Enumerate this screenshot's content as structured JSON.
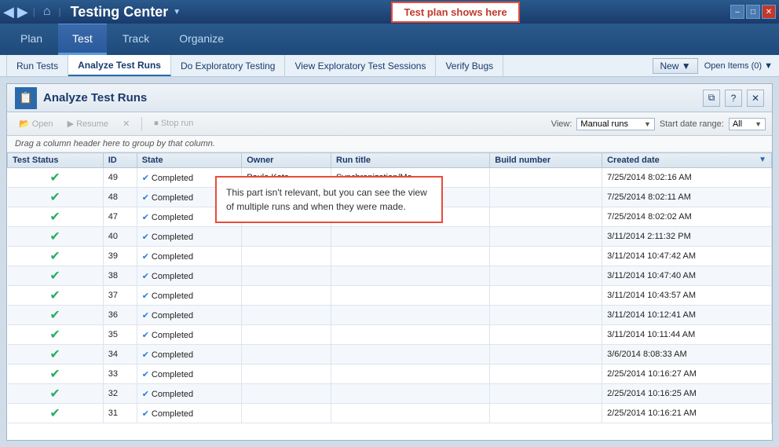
{
  "window": {
    "title": "Testing Center",
    "min_label": "–",
    "max_label": "□",
    "close_label": "✕"
  },
  "titlebar": {
    "back_icon": "◀",
    "forward_icon": "▶",
    "home_icon": "⌂",
    "dropdown_arrow": "▼",
    "test_plan_badge": "Test plan shows here"
  },
  "top_nav": {
    "items": [
      {
        "label": "Plan",
        "active": false
      },
      {
        "label": "Test",
        "active": true
      },
      {
        "label": "Track",
        "active": false
      },
      {
        "label": "Organize",
        "active": false
      }
    ]
  },
  "secondary_nav": {
    "items": [
      {
        "label": "Run Tests",
        "active": false
      },
      {
        "label": "Analyze Test Runs",
        "active": true
      },
      {
        "label": "Do Exploratory Testing",
        "active": false
      },
      {
        "label": "View Exploratory Test Sessions",
        "active": false
      },
      {
        "label": "Verify Bugs",
        "active": false
      }
    ],
    "new_btn": "New ▼",
    "open_items": "Open Items (0) ▼"
  },
  "panel": {
    "title": "Analyze Test Runs",
    "icon": "📋",
    "restore_icon": "⧉",
    "help_icon": "?",
    "close_icon": "✕"
  },
  "toolbar": {
    "open_btn": "Open",
    "resume_btn": "Resume",
    "delete_btn": "✕",
    "stop_btn": "⏹ Stop run",
    "view_label": "View:",
    "view_value": "Manual runs",
    "date_label": "Start date range:",
    "date_value": "All"
  },
  "drag_hint": "Drag a column header here to group by that column.",
  "table": {
    "columns": [
      {
        "label": "Test Status"
      },
      {
        "label": "ID"
      },
      {
        "label": "State"
      },
      {
        "label": "Owner"
      },
      {
        "label": "Run title"
      },
      {
        "label": "Build number"
      },
      {
        "label": "Created date"
      }
    ],
    "rows": [
      {
        "status": "✅",
        "id": "49",
        "state": "Completed",
        "owner": "Paula Kata",
        "run_title": "Synchronization/Mo...",
        "build": "",
        "created": "7/25/2014 8:02:16 AM"
      },
      {
        "status": "✅",
        "id": "48",
        "state": "Completed",
        "owner": "",
        "run_title": "",
        "build": "",
        "created": "7/25/2014 8:02:11 AM"
      },
      {
        "status": "✅",
        "id": "47",
        "state": "Completed",
        "owner": "",
        "run_title": "",
        "build": "",
        "created": "7/25/2014 8:02:02 AM"
      },
      {
        "status": "✅",
        "id": "40",
        "state": "Completed",
        "owner": "",
        "run_title": "",
        "build": "",
        "created": "3/11/2014 2:11:32 PM"
      },
      {
        "status": "✅",
        "id": "39",
        "state": "Completed",
        "owner": "",
        "run_title": "",
        "build": "",
        "created": "3/11/2014 10:47:42 AM"
      },
      {
        "status": "✅",
        "id": "38",
        "state": "Completed",
        "owner": "",
        "run_title": "",
        "build": "",
        "created": "3/11/2014 10:47:40 AM"
      },
      {
        "status": "✅",
        "id": "37",
        "state": "Completed",
        "owner": "",
        "run_title": "",
        "build": "",
        "created": "3/11/2014 10:43:57 AM"
      },
      {
        "status": "✅",
        "id": "36",
        "state": "Completed",
        "owner": "",
        "run_title": "",
        "build": "",
        "created": "3/11/2014 10:12:41 AM"
      },
      {
        "status": "✅",
        "id": "35",
        "state": "Completed",
        "owner": "",
        "run_title": "",
        "build": "",
        "created": "3/11/2014 10:11:44 AM"
      },
      {
        "status": "✅",
        "id": "34",
        "state": "Completed",
        "owner": "",
        "run_title": "",
        "build": "",
        "created": "3/6/2014 8:08:33 AM"
      },
      {
        "status": "✅",
        "id": "33",
        "state": "Completed",
        "owner": "",
        "run_title": "",
        "build": "",
        "created": "2/25/2014 10:16:27 AM"
      },
      {
        "status": "✅",
        "id": "32",
        "state": "Completed",
        "owner": "",
        "run_title": "",
        "build": "",
        "created": "2/25/2014 10:16:25 AM"
      },
      {
        "status": "✅",
        "id": "31",
        "state": "Completed",
        "owner": "",
        "run_title": "",
        "build": "",
        "created": "2/25/2014 10:16:21 AM"
      }
    ]
  },
  "annotation": {
    "text": "This part isn't relevant, but you can see the view of multiple runs and when they were made."
  }
}
